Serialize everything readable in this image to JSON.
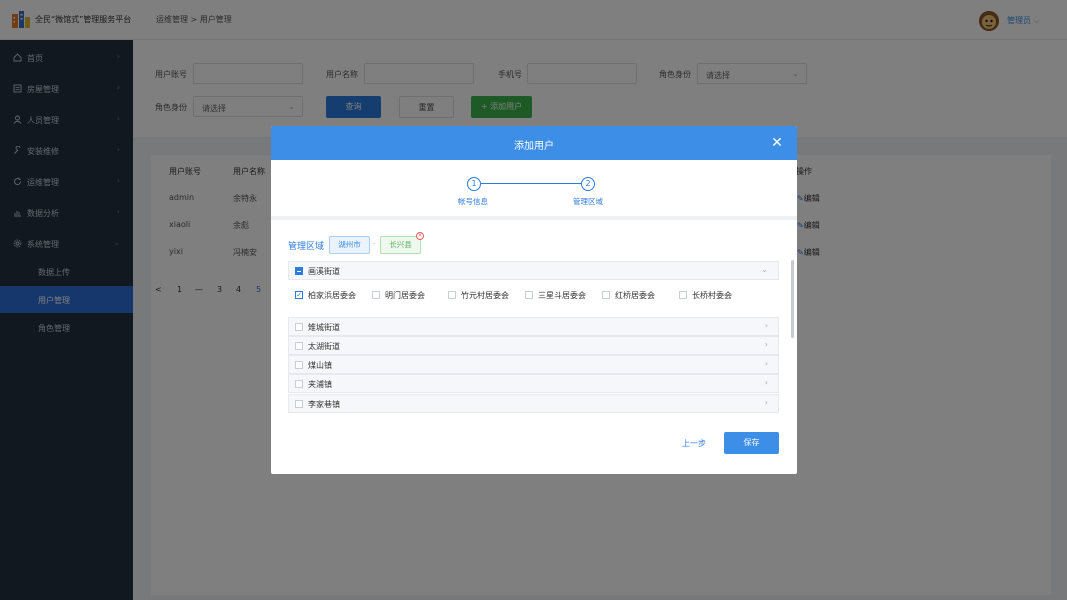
{
  "app": {
    "title": "全民“微馆式”管理服务平台",
    "breadcrumb": "运维管理 > 用户管理",
    "username": "管理员"
  },
  "sidebar": {
    "items": [
      {
        "label": "首页",
        "icon": "home-icon"
      },
      {
        "label": "房屋管理",
        "icon": "house-doc-icon"
      },
      {
        "label": "人员管理",
        "icon": "person-icon"
      },
      {
        "label": "安装维修",
        "icon": "wrench-icon"
      },
      {
        "label": "运维管理",
        "icon": "refresh-icon"
      },
      {
        "label": "数据分析",
        "icon": "chart-icon"
      },
      {
        "label": "系统管理",
        "icon": "gear-icon"
      }
    ],
    "subitems": [
      {
        "label": "数据上传"
      },
      {
        "label": "用户管理"
      },
      {
        "label": "角色管理"
      }
    ]
  },
  "filter": {
    "account_label": "用户账号",
    "name_label": "用户名称",
    "phone_label": "手机号",
    "role_label": "角色身份",
    "role_label2": "角色身份",
    "role_placeholder": "请选择",
    "role_placeholder2": "请选择",
    "search_button": "查询",
    "reset_button": "重置",
    "add_button": "添加用户"
  },
  "table": {
    "headers": [
      "用户账号",
      "用户名称",
      "操作"
    ],
    "rows": [
      {
        "account": "admin",
        "name": "余特永",
        "action": "编辑"
      },
      {
        "account": "xiaoli",
        "name": "余彪",
        "action": "编辑"
      },
      {
        "account": "yixi",
        "name": "冯楠安",
        "action": "编辑"
      }
    ]
  },
  "pagination": {
    "prev": "<",
    "pages": [
      "1",
      "—",
      "3",
      "4",
      "5"
    ]
  },
  "modal": {
    "title": "添加用户",
    "steps": [
      {
        "num": "1",
        "label": "帐号信息"
      },
      {
        "num": "2",
        "label": "管理区域"
      }
    ],
    "area_label": "管理区域",
    "tag_city": "湖州市",
    "tag_county": "长兴县",
    "separator": "-",
    "expanded_group": "画溪街道",
    "villages": [
      {
        "label": "柏家浜居委会",
        "checked": true
      },
      {
        "label": "明门居委会",
        "checked": false
      },
      {
        "label": "竹元村居委会",
        "checked": false
      },
      {
        "label": "三星斗居委会",
        "checked": false
      },
      {
        "label": "红桥居委会",
        "checked": false
      },
      {
        "label": "长桥村委会",
        "checked": false
      }
    ],
    "groups": [
      {
        "label": "雉城街道"
      },
      {
        "label": "太湖街道"
      },
      {
        "label": "煤山镇"
      },
      {
        "label": "夹浦镇"
      },
      {
        "label": "李家巷镇"
      }
    ],
    "prev_button": "上一步",
    "save_button": "保存"
  },
  "colors": {
    "primary": "#3d8ee6",
    "sidebar": "#243040",
    "active": "#2d6fd6",
    "add": "#3bb44a",
    "tag_city": "#3a8ee6",
    "tag_county": "#5cb85c"
  }
}
